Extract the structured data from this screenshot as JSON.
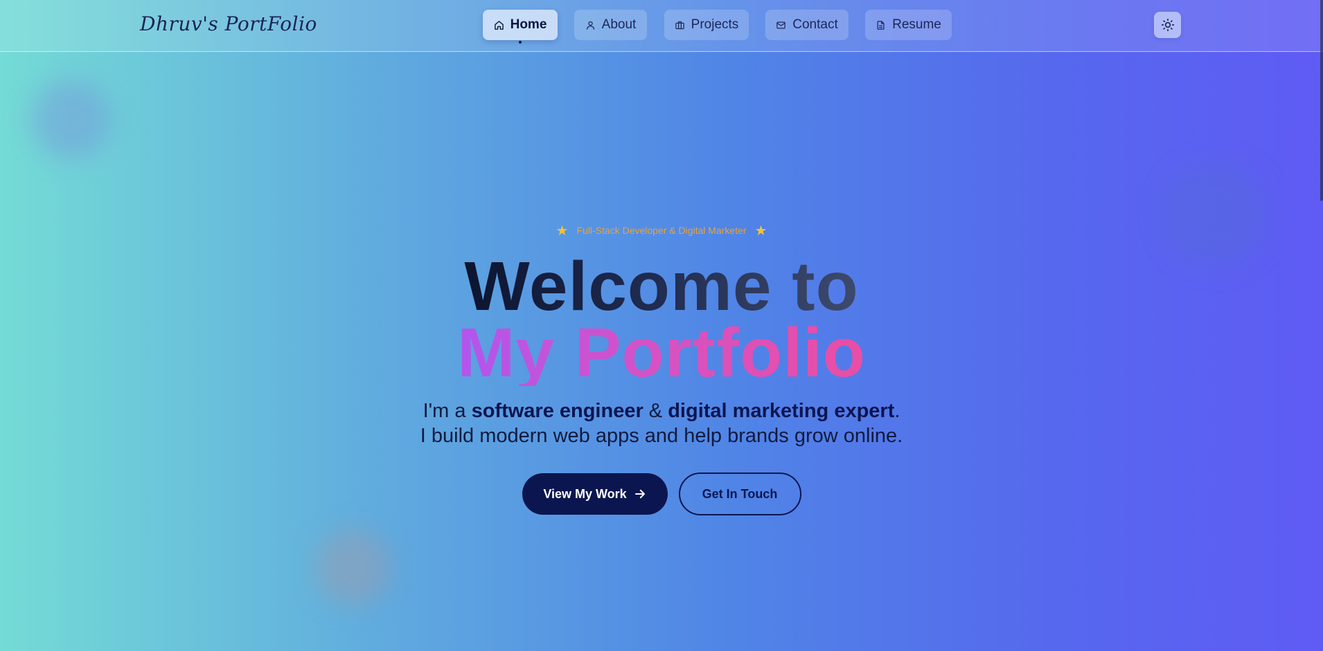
{
  "brand": "Dhruv's PortFolio",
  "nav": {
    "items": [
      {
        "label": "Home",
        "icon": "home-icon",
        "active": true
      },
      {
        "label": "About",
        "icon": "user-icon"
      },
      {
        "label": "Projects",
        "icon": "briefcase-icon"
      },
      {
        "label": "Contact",
        "icon": "mail-icon"
      },
      {
        "label": "Resume",
        "icon": "file-icon"
      }
    ]
  },
  "theme_toggle": {
    "icon": "sun-icon"
  },
  "hero": {
    "tagline": "Full-Stack Developer & Digital Marketer",
    "tagline_icon": "star-icon",
    "title_line1": "Welcome to",
    "title_line2": "My Portfolio",
    "subtitle": {
      "prefix": "I'm a ",
      "bold1": "software engineer",
      "mid": " & ",
      "bold2": "digital marketing expert",
      "suffix": ".",
      "line2": "I build modern web apps and help brands grow online."
    },
    "primary_button": "View My Work",
    "secondary_button": "Get In Touch"
  },
  "colors": {
    "accent_dark": "#0b1650",
    "tagline": "#e8a23a",
    "gradient_start": "#74dbd6",
    "gradient_end": "#5f5bf4"
  }
}
